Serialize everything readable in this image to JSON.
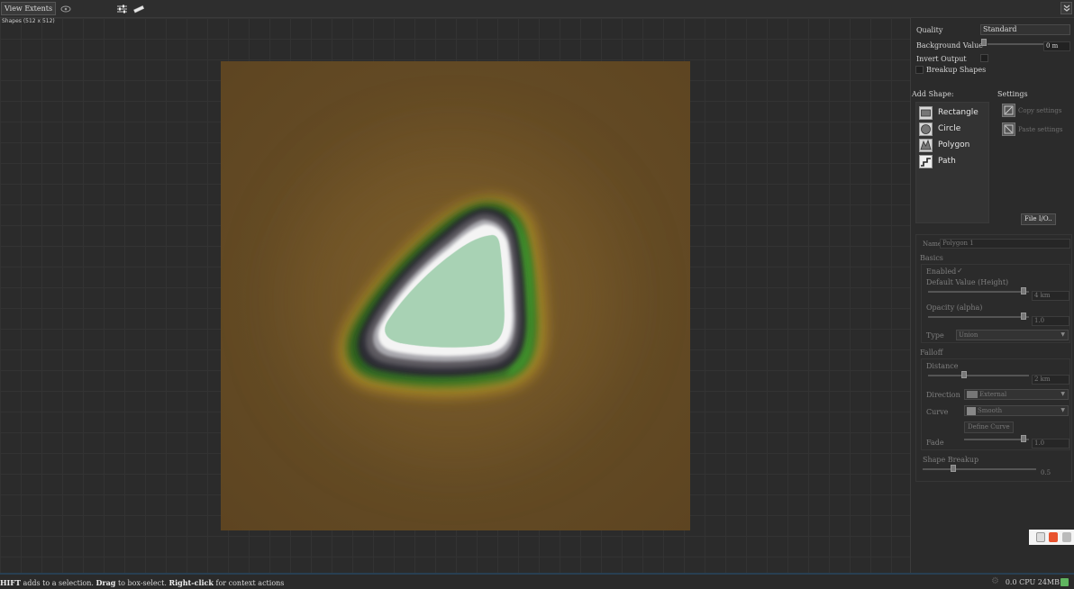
{
  "toolbar": {
    "view_extents": "View Extents",
    "icons": [
      "eye-icon",
      "adjust-sliders-icon",
      "ruler-icon",
      "collapse-chevron-icon"
    ]
  },
  "canvas": {
    "label": "Shapes (512 x 512)",
    "colors": {
      "terrain": "#6b5026",
      "inner": "#a8d2b4",
      "rim": "#ffffff",
      "falloff_green": "#2f6b22",
      "falloff_yellow": "#c89a1e"
    }
  },
  "panel": {
    "quality": {
      "label": "Quality",
      "value": "Standard"
    },
    "background_value": {
      "label": "Background Value",
      "value": "0 m"
    },
    "invert_output": {
      "label": "Invert Output"
    },
    "breakup_shapes": {
      "label": "Breakup Shapes"
    },
    "add_shape_label": "Add Shape:",
    "settings_label": "Settings",
    "shapes": [
      {
        "label": "Rectangle",
        "icon": "rectangle-icon"
      },
      {
        "label": "Circle",
        "icon": "circle-icon"
      },
      {
        "label": "Polygon",
        "icon": "polygon-icon"
      },
      {
        "label": "Path",
        "icon": "path-icon"
      }
    ],
    "settings": [
      {
        "label": "Copy settings",
        "icon": "copy-settings-icon"
      },
      {
        "label": "Paste settings",
        "icon": "paste-settings-icon"
      }
    ],
    "file_io": "File I/O..",
    "name": {
      "label": "Name",
      "value": "Polygon 1"
    },
    "basics_label": "Basics",
    "enabled": {
      "label": "Enabled",
      "check": "✓"
    },
    "default_value": {
      "label": "Default Value (Height)",
      "value": "4 km"
    },
    "opacity": {
      "label": "Opacity (alpha)",
      "value": "1.0"
    },
    "type": {
      "label": "Type",
      "value": "Union"
    },
    "falloff_label": "Falloff",
    "distance": {
      "label": "Distance",
      "value": "2 km"
    },
    "direction": {
      "label": "Direction",
      "value": "External"
    },
    "curve": {
      "label": "Curve",
      "value": "Smooth"
    },
    "define_curve": "Define Curve",
    "fade": {
      "label": "Fade",
      "value": "1.0"
    },
    "shape_breakup": {
      "label": "Shape Breakup",
      "value": "0.5"
    }
  },
  "status": {
    "shift": "HIFT",
    "t1": " adds to a selection. ",
    "drag": "Drag",
    "t2": " to box-select. ",
    "rclick": "Right-click",
    "t3": " for context actions",
    "right": "0.0 CPU 24MB"
  }
}
